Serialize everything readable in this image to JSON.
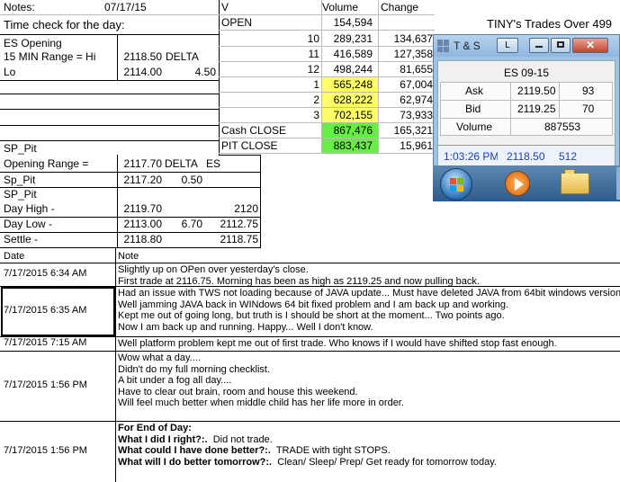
{
  "header": {
    "notes_label": "Notes:",
    "date": "07/17/15",
    "time_check": "Time check for the day:"
  },
  "es_opening": {
    "title": "ES Opening",
    "range_label": "15 MIN Range = Hi",
    "hi_value": "2118.50",
    "delta_label": "DELTA",
    "lo_label": "Lo",
    "lo_value": "2114.00",
    "delta_value": "4.50"
  },
  "volume_table": {
    "col_v": "V",
    "col_volume": "Volume",
    "col_change": "Change",
    "rows": [
      {
        "label": "OPEN",
        "volume": "154,594",
        "change": "",
        "hl": ""
      },
      {
        "label": "10",
        "volume": "289,231",
        "change": "134,637",
        "hl": ""
      },
      {
        "label": "11",
        "volume": "416,589",
        "change": "127,358",
        "hl": ""
      },
      {
        "label": "12",
        "volume": "498,244",
        "change": "81,655",
        "hl": ""
      },
      {
        "label": "1",
        "volume": "565,248",
        "change": "67,004",
        "hl": "yellow"
      },
      {
        "label": "2",
        "volume": "628,222",
        "change": "62,974",
        "hl": "yellow"
      },
      {
        "label": "3",
        "volume": "702,155",
        "change": "73,933",
        "hl": "yellow"
      },
      {
        "label": "Cash CLOSE",
        "volume": "867,476",
        "change": "165,321",
        "hl": "green"
      },
      {
        "label": "PIT CLOSE",
        "volume": "883,437",
        "change": "15,961",
        "hl": "green"
      }
    ]
  },
  "tiny_title": "TINY's Trades Over 499",
  "sp_pit": {
    "title1": "SP_Pit",
    "opening_range_label": "Opening Range =",
    "opening_range_value": "2117.70",
    "delta_label": "DELTA",
    "es_label": "ES",
    "sp_pit_label": "Sp_Pit",
    "sp_pit_value": "2117.20",
    "sp_delta": "0.50",
    "title2": "SP_Pit",
    "day_high_label": "Day High -",
    "day_high_value": "2119.70",
    "day_high_es": "2120",
    "day_low_label": "Day Low -",
    "day_low_value": "2113.00",
    "day_low_delta": "6.70",
    "day_low_es": "2112.75",
    "settle_label": "Settle -",
    "settle_value": "2118.80",
    "settle_es": "2118.75"
  },
  "notes_table": {
    "col_date": "Date",
    "col_note": "Note",
    "rows": [
      {
        "date": "7/17/2015 6:34 AM",
        "lines": [
          "Slightly up on OPen over yesterday's close.",
          "First trade at 2116.75.  Morning has been as high as 2119.25 and now pulling back."
        ]
      },
      {
        "date": "7/17/2015 6:35 AM",
        "lines": [
          "Had an issue with TWS not loading because of JAVA update... Must have deleted JAVA from 64bit windows version.",
          "Well jamming JAVA back in WINdows 64 bit fixed problem and I am back up and working.",
          "Kept me out of going long, but truth is I should be short at the moment... Two points ago.",
          "Now I am back up and running.  Happy... Well I don't know."
        ]
      },
      {
        "date": "7/17/2015 7:15 AM",
        "lines": [
          "Well platform problem kept me out of first trade.  Who knows if I would have shifted stop fast enough."
        ]
      },
      {
        "date": "7/17/2015 1:56 PM",
        "lines": [
          "Wow what a day....",
          "Didn't do my full morning checklist.",
          "A bit under a fog all day....",
          "Have to clear out brain, room and house this weekend.",
          "Will feel much better when middle child has her life more in order."
        ]
      },
      {
        "date": "7/17/2015 1:56 PM",
        "bold_lines": [
          {
            "b": "For End of Day:",
            "t": ""
          },
          {
            "b": "What I did I right?:.",
            "t": "  Did not trade."
          },
          {
            "b": "What could I have done better?:.",
            "t": "  TRADE with tight STOPS."
          },
          {
            "b": "What will I do better tomorrow?:.",
            "t": "  Clean/ Sleep/ Prep/ Get ready for tomorrow today."
          }
        ]
      }
    ]
  },
  "ts_window": {
    "title": "T & S",
    "l_button": "L",
    "symbol": "ES 09-15",
    "ask_label": "Ask",
    "ask_price": "2119.50",
    "ask_size": "93",
    "bid_label": "Bid",
    "bid_price": "2119.25",
    "bid_size": "70",
    "volume_label": "Volume",
    "volume_value": "887553",
    "tick_time": "1:03:26 PM",
    "tick_price": "2118.50",
    "tick_size": "512",
    "colors": {
      "title_bg": "#a9cbeb",
      "tick_text": "#1a3fb5"
    }
  },
  "taskbar_icons": [
    "windows-start-icon",
    "media-player-icon",
    "folder-icon"
  ]
}
